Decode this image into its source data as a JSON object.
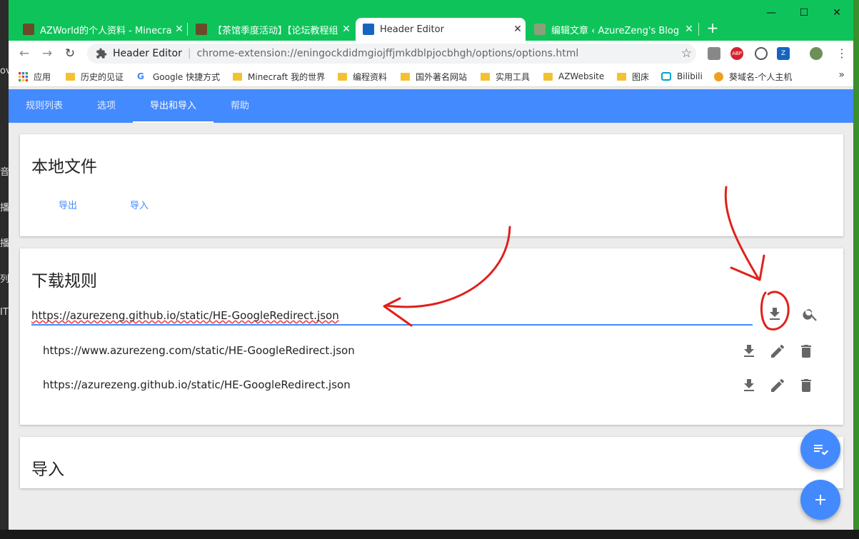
{
  "desktop": {
    "left_fragments": [
      "ov",
      "音",
      "播",
      "播",
      "列",
      "IT"
    ]
  },
  "browser": {
    "tabs": [
      {
        "title": "AZWorld的个人资料 - Minecraf",
        "active": false
      },
      {
        "title": "【茶馆季度活动】【论坛教程组】",
        "active": false
      },
      {
        "title": "Header Editor",
        "active": true
      },
      {
        "title": "编辑文章 ‹ AzureZeng's Blog —",
        "active": false
      }
    ],
    "tab_close_glyph": "✕",
    "new_tab_glyph": "+",
    "window_controls": {
      "minimize": "—",
      "maximize": "☐",
      "close": "✕"
    },
    "nav": {
      "back": "←",
      "forward": "→",
      "reload": "↻"
    },
    "omnibox": {
      "page_name": "Header Editor",
      "separator": "|",
      "url": "chrome-extension://eningockdidmgiojffjmkdblpjocbhgh/options/options.html",
      "star": "☆"
    },
    "extensions": [
      {
        "name": "ext-gray-icon",
        "color": "#888888",
        "label": ""
      },
      {
        "name": "abp-icon",
        "color": "#d3232f",
        "label": "ABP"
      },
      {
        "name": "ext-circle-icon",
        "color": "#555555",
        "label": ""
      },
      {
        "name": "header-editor-ext-icon",
        "color": "#1565c0",
        "label": "Z"
      },
      {
        "name": "profile-avatar-icon",
        "color": "#6d8f5a",
        "label": ""
      }
    ],
    "menu_glyph": "⋮",
    "bookmarks": [
      {
        "label": "应用",
        "icon": "apps"
      },
      {
        "label": "历史的见证",
        "icon": "folder"
      },
      {
        "label": "Google 快捷方式",
        "icon": "google"
      },
      {
        "label": "Minecraft 我的世界",
        "icon": "folder"
      },
      {
        "label": "编程资料",
        "icon": "folder"
      },
      {
        "label": "国外著名网站",
        "icon": "folder"
      },
      {
        "label": "实用工具",
        "icon": "folder"
      },
      {
        "label": "AZWebsite",
        "icon": "folder"
      },
      {
        "label": "图床",
        "icon": "folder"
      },
      {
        "label": "Bilibili",
        "icon": "bilibili"
      },
      {
        "label": "葵域名-个人主机",
        "icon": "coin"
      }
    ],
    "bookmarks_more": "»"
  },
  "app": {
    "accent": "#448aff",
    "tabs": [
      {
        "label": "规则列表",
        "active": false
      },
      {
        "label": "选项",
        "active": false
      },
      {
        "label": "导出和导入",
        "active": true
      },
      {
        "label": "帮助",
        "active": false
      }
    ],
    "local_file": {
      "title": "本地文件",
      "export_label": "导出",
      "import_label": "导入"
    },
    "download_rules": {
      "title": "下载规则",
      "url_input_value": "https://azurezeng.github.io/static/HE-GoogleRedirect.json",
      "history": [
        "https://www.azurezeng.com/static/HE-GoogleRedirect.json",
        "https://azurezeng.github.io/static/HE-GoogleRedirect.json"
      ]
    },
    "import_card": {
      "title": "导入"
    }
  },
  "annotation": {
    "color": "#e0201c"
  }
}
